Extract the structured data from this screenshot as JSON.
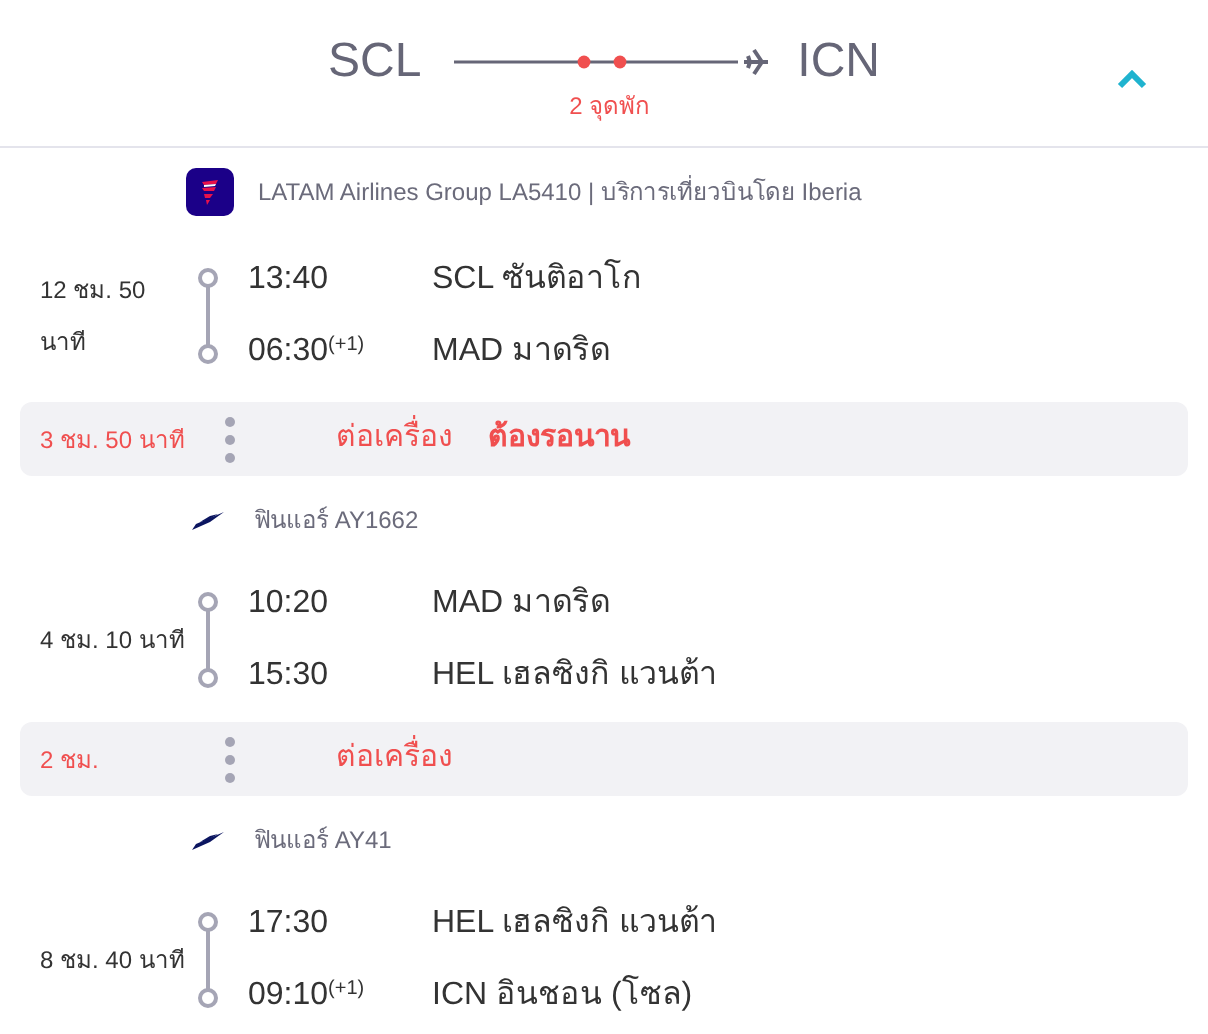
{
  "header": {
    "origin": "SCL",
    "destination": "ICN",
    "stops": "2 จุดพัก",
    "expanded": true
  },
  "items": [
    {
      "kind": "segment",
      "airline": {
        "kind": "latam",
        "name": "LATAM Airlines Group LA5410 | บริการเที่ยวบินโดย Iberia"
      },
      "duration": "12 ชม. 50 นาที",
      "departure": {
        "time": "13:40",
        "place": "SCL ซันติอาโก"
      },
      "arrival": {
        "time": "06:30",
        "day_offset": "(+1)",
        "place": "MAD มาดริด"
      }
    },
    {
      "kind": "layover",
      "duration": "3 ชม. 50 นาที",
      "label": "ต่อเครื่อง",
      "warning": "ต้องรอนาน"
    },
    {
      "kind": "segment",
      "airline": {
        "kind": "finnair",
        "name": "ฟินแอร์ AY1662"
      },
      "duration": "4 ชม. 10 นาที",
      "departure": {
        "time": "10:20",
        "place": "MAD มาดริด"
      },
      "arrival": {
        "time": "15:30",
        "place": "HEL เฮลซิงกิ แวนต้า"
      }
    },
    {
      "kind": "layover",
      "duration": "2 ชม.",
      "label": "ต่อเครื่อง"
    },
    {
      "kind": "segment",
      "airline": {
        "kind": "finnair",
        "name": "ฟินแอร์ AY41"
      },
      "duration": "8 ชม. 40 นาที",
      "departure": {
        "time": "17:30",
        "place": "HEL เฮลซิงกิ แวนต้า"
      },
      "arrival": {
        "time": "09:10",
        "day_offset": "(+1)",
        "place": "ICN อินชอน (โซล)"
      }
    }
  ]
}
